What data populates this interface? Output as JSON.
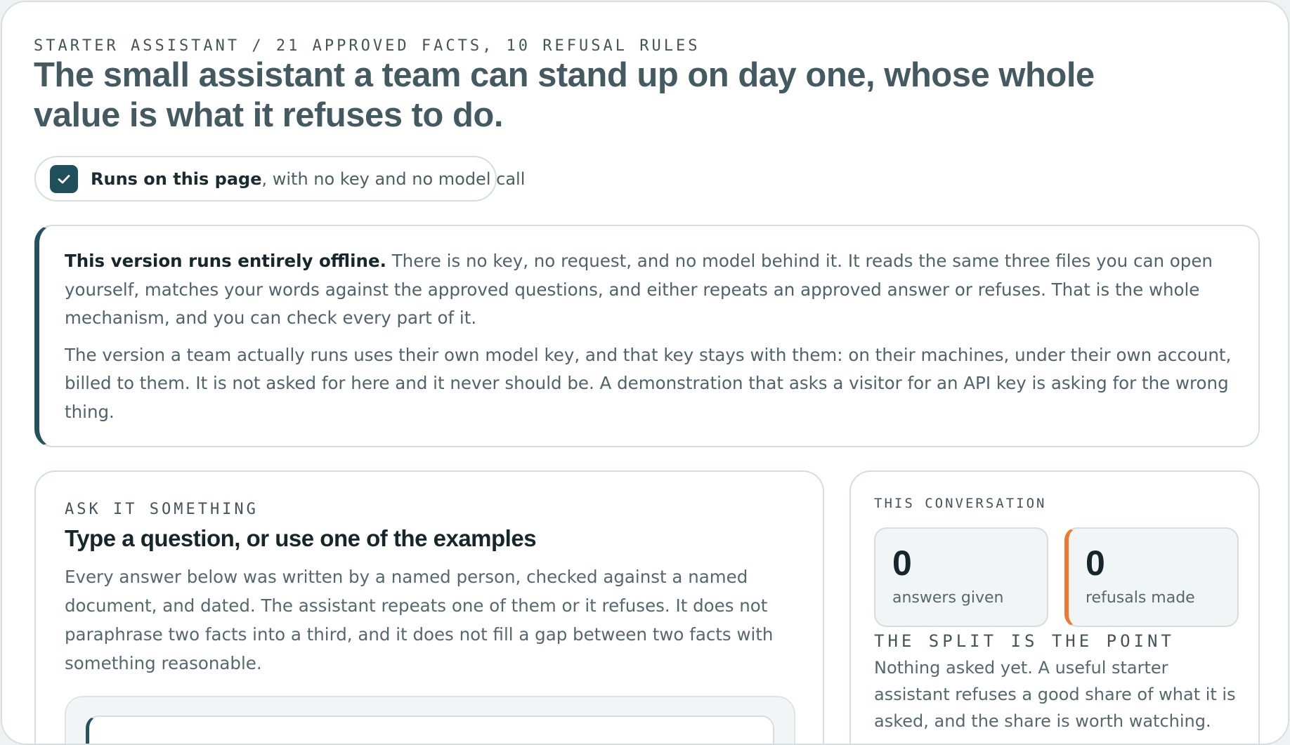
{
  "header": {
    "eyebrow": "STARTER ASSISTANT / 21 APPROVED FACTS, 10 REFUSAL RULES",
    "title": "The small assistant a team can stand up on day one, whose whole value is what it refuses to do."
  },
  "status_pill": {
    "icon": "checkmark-icon",
    "strong": "Runs on this page",
    "rest": ", with no key and no model call",
    "accent": "#1f4f5a"
  },
  "notice": {
    "p1_strong": "This version runs entirely offline.",
    "p1_rest": " There is no key, no request, and no model behind it. It reads the same three files you can open yourself, matches your words against the approved questions, and either repeats an approved answer or refuses. That is the whole mechanism, and you can check every part of it.",
    "p2": "The version a team actually runs uses their own model key, and that key stays with them: on their machines, under their own account, billed to them. It is not asked for here and it never should be. A demonstration that asks a visitor for an API key is asking for the wrong thing."
  },
  "ask": {
    "eyebrow": "ASK IT SOMETHING",
    "title": "Type a question, or use one of the examples",
    "description": "Every answer below was written by a named person, checked against a named document, and dated. The assistant repeats one of them or it refuses. It does not paraphrase two facts into a third, and it does not fill a gap between two facts with something reasonable."
  },
  "conversation": {
    "eyebrow": "THIS CONVERSATION",
    "answers_count": "0",
    "answers_label": "answers given",
    "refusals_count": "0",
    "refusals_label": "refusals made",
    "refusal_accent": "#ee7a32",
    "split_title": "THE SPLIT IS THE POINT",
    "split_text": "Nothing asked yet. A useful starter assistant refuses a good share of what it is asked, and the share is worth watching."
  }
}
